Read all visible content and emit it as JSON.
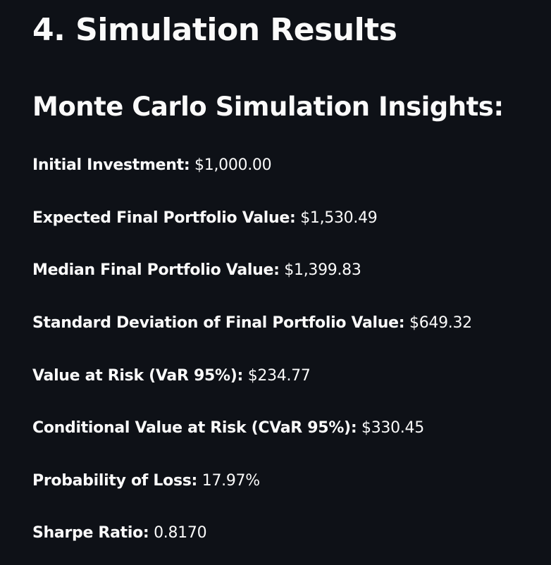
{
  "header": {
    "title": "4. Simulation Results"
  },
  "insights": {
    "heading": "Monte Carlo Simulation Insights:",
    "metrics": [
      {
        "label": "Initial Investment:",
        "value": "$1,000.00"
      },
      {
        "label": "Expected Final Portfolio Value:",
        "value": "$1,530.49"
      },
      {
        "label": "Median Final Portfolio Value:",
        "value": "$1,399.83"
      },
      {
        "label": "Standard Deviation of Final Portfolio Value:",
        "value": "$649.32"
      },
      {
        "label": "Value at Risk (VaR 95%):",
        "value": "$234.77"
      },
      {
        "label": "Conditional Value at Risk (CVaR 95%):",
        "value": "$330.45"
      },
      {
        "label": "Probability of Loss:",
        "value": "17.97%"
      },
      {
        "label": "Sharpe Ratio:",
        "value": "0.8170"
      }
    ]
  },
  "colors": {
    "background": "#0e1117",
    "text": "#fafafa"
  }
}
